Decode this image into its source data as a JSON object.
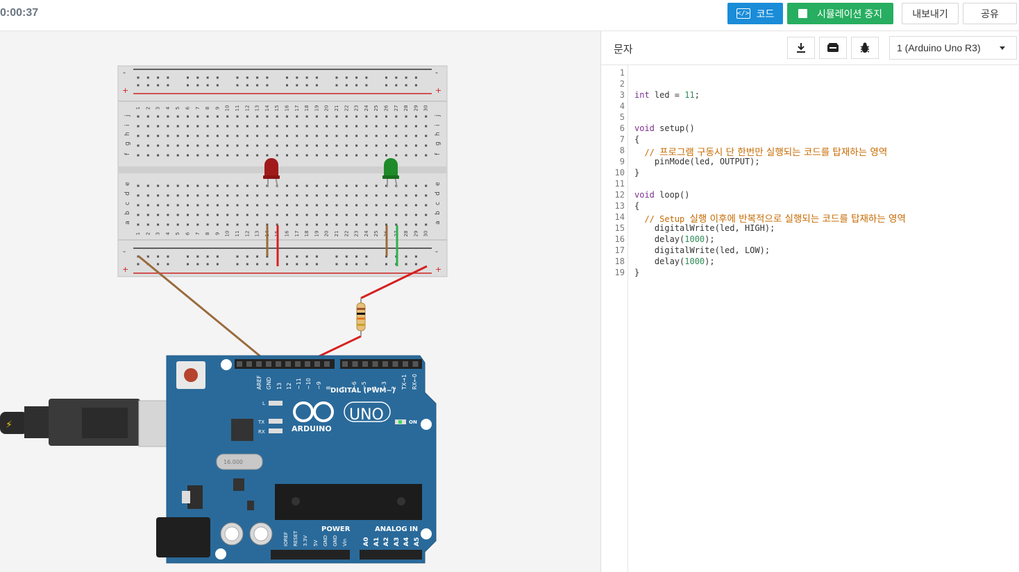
{
  "topbar": {
    "timer": "0:00:37",
    "code_button": "코드",
    "sim_button": "시뮬레이션 중지",
    "export_button": "내보내기",
    "share_button": "공유"
  },
  "code_panel": {
    "mode": "문자",
    "board": "1 (Arduino Uno R3)",
    "tools": [
      "download-icon",
      "library-icon",
      "debug-icon"
    ],
    "line_numbers": [
      "1",
      "2",
      "3",
      "4",
      "5",
      "6",
      "7",
      "8",
      "9",
      "10",
      "11",
      "12",
      "13",
      "14",
      "15",
      "16",
      "17",
      "18",
      "19"
    ],
    "code": {
      "l3_kw": "int",
      "l3_rest": " led = ",
      "l3_num": "11",
      "l3_end": ";",
      "l6_kw": "void",
      "l6_rest": " setup()",
      "l7": "{",
      "l8_slash": "  // ",
      "l8_text": "프로그램 구동시 단 한번만 실행되는 코드를 탑재하는 영역",
      "l9": "    pinMode(led, OUTPUT);",
      "l10": "}",
      "l12_kw": "void",
      "l12_rest": " loop()",
      "l13": "{",
      "l14_slash": "  // Setup ",
      "l14_text": "실행 이후에 반복적으로 실행되는 코드를 탑재하는 영역",
      "l15": "    digitalWrite(led, HIGH);",
      "l16_pre": "    delay(",
      "l16_num": "1000",
      "l16_end": ");",
      "l17": "    digitalWrite(led, LOW);",
      "l18_pre": "    delay(",
      "l18_num": "1000",
      "l18_end": ");",
      "l19": "}"
    }
  },
  "breadboard": {
    "rail_minus": "-",
    "rail_plus": "+",
    "column_numbers": [
      "1",
      "2",
      "3",
      "4",
      "5",
      "6",
      "7",
      "8",
      "9",
      "10",
      "11",
      "12",
      "13",
      "14",
      "15",
      "16",
      "17",
      "18",
      "19",
      "20",
      "21",
      "22",
      "23",
      "24",
      "25",
      "26",
      "27",
      "28",
      "29",
      "30"
    ],
    "rows_top": [
      "j",
      "i",
      "h",
      "g",
      "f"
    ],
    "rows_bottom": [
      "e",
      "d",
      "c",
      "b",
      "a"
    ]
  },
  "components": {
    "led_red_color": "#a01a1a",
    "led_green_color": "#1f8a2a",
    "wire_brown": "#9a6b3c",
    "wire_red": "#d62020",
    "wire_green": "#2db24a"
  },
  "arduino": {
    "brand": "ARDUINO",
    "model": "UNO",
    "on_label": "ON",
    "l_label": "L",
    "tx_label": "TX",
    "rx_label": "RX",
    "digital_label": "DIGITAL (PWM~)",
    "power_label": "POWER",
    "analog_label": "ANALOG IN",
    "digital_pins": [
      "AREF",
      "GND",
      "13",
      "12",
      "~11",
      "~10",
      "~9",
      "8",
      "7",
      "~6",
      "~5",
      "4",
      "~3",
      "2",
      "TX→1",
      "RX←0"
    ],
    "power_pins": [
      "IOREF",
      "RESET",
      "3.3V",
      "5V",
      "GND",
      "GND",
      "Vin"
    ],
    "analog_pins": [
      "A0",
      "A1",
      "A2",
      "A3",
      "A4",
      "A5"
    ],
    "crystal": "16.000"
  }
}
